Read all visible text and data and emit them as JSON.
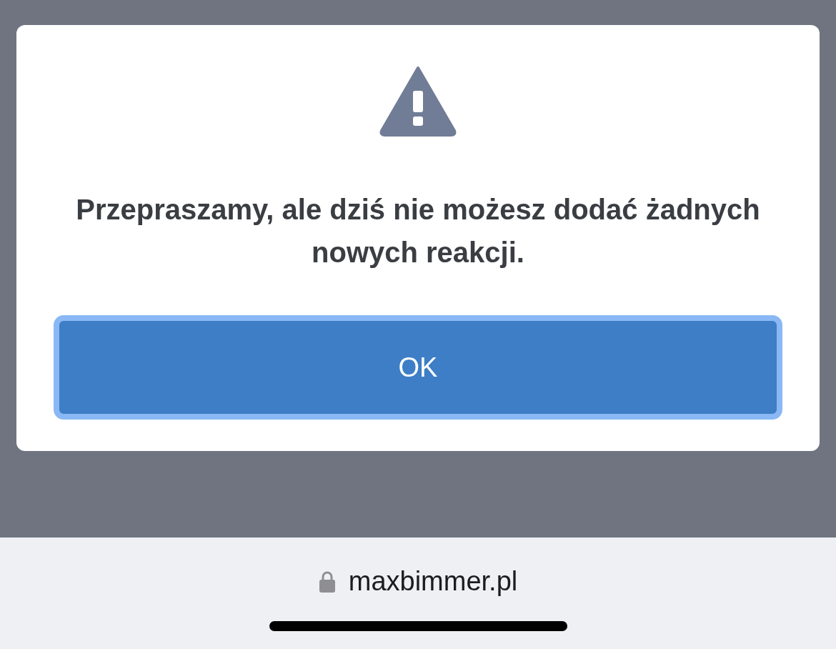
{
  "dialog": {
    "message": "Przepraszamy, ale dziś nie możesz dodać żadnych nowych reakcji.",
    "button": {
      "label": "OK"
    }
  },
  "address_bar": {
    "url": "maxbimmer.pl"
  }
}
